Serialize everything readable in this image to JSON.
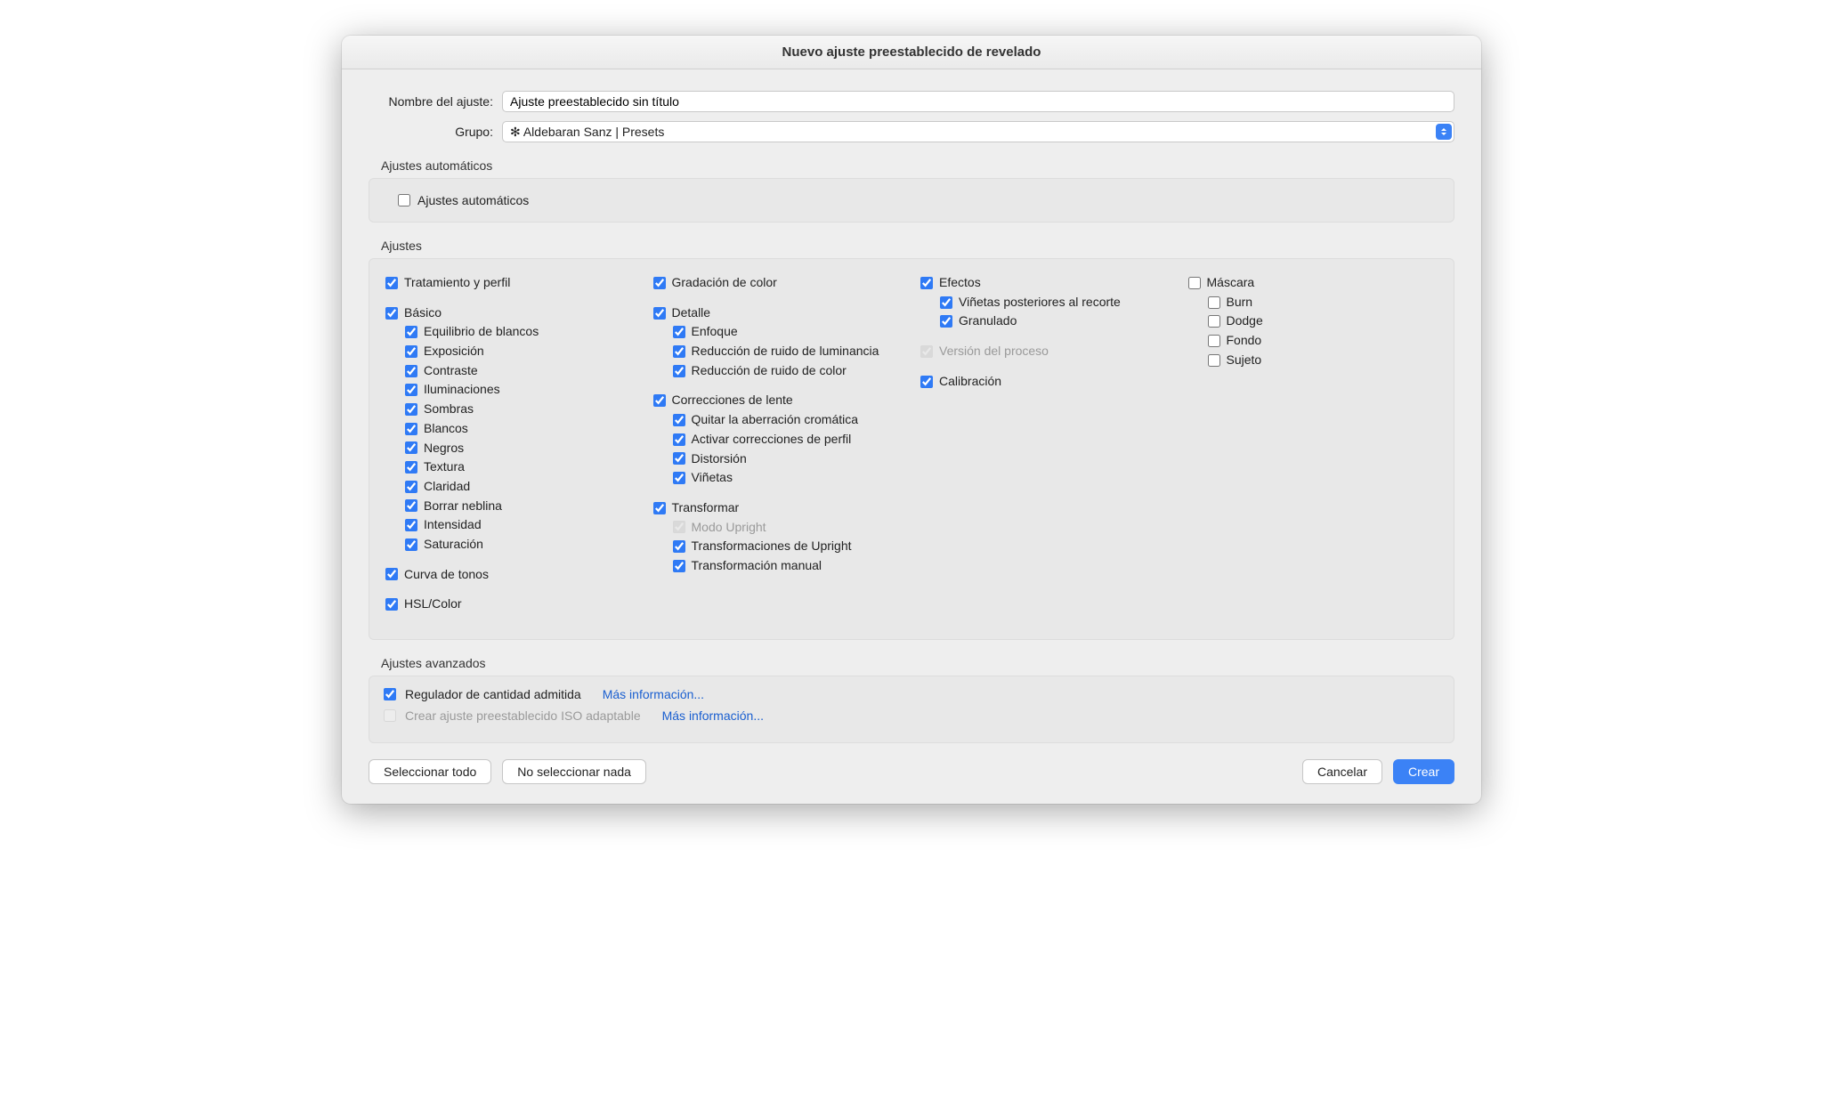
{
  "title": "Nuevo ajuste preestablecido de revelado",
  "form": {
    "name_label": "Nombre del ajuste:",
    "name_value": "Ajuste preestablecido sin título",
    "group_label": "Grupo:",
    "group_value": "✻ Aldebaran Sanz | Presets"
  },
  "auto": {
    "section": "Ajustes automáticos",
    "option": "Ajustes automáticos",
    "checked": false
  },
  "settings_title": "Ajustes",
  "col1": [
    {
      "label": "Tratamiento y perfil",
      "checked": true,
      "children": []
    },
    {
      "label": "Básico",
      "checked": true,
      "children": [
        {
          "label": "Equilibrio de blancos",
          "checked": true
        },
        {
          "label": "Exposición",
          "checked": true
        },
        {
          "label": "Contraste",
          "checked": true
        },
        {
          "label": "Iluminaciones",
          "checked": true
        },
        {
          "label": "Sombras",
          "checked": true
        },
        {
          "label": "Blancos",
          "checked": true
        },
        {
          "label": "Negros",
          "checked": true
        },
        {
          "label": "Textura",
          "checked": true
        },
        {
          "label": "Claridad",
          "checked": true
        },
        {
          "label": "Borrar neblina",
          "checked": true
        },
        {
          "label": "Intensidad",
          "checked": true
        },
        {
          "label": "Saturación",
          "checked": true
        }
      ]
    },
    {
      "label": "Curva de tonos",
      "checked": true,
      "children": []
    },
    {
      "label": "HSL/Color",
      "checked": true,
      "children": []
    }
  ],
  "col2": [
    {
      "label": "Gradación de color",
      "checked": true,
      "children": []
    },
    {
      "label": "Detalle",
      "checked": true,
      "children": [
        {
          "label": "Enfoque",
          "checked": true
        },
        {
          "label": "Reducción de ruido de luminancia",
          "checked": true
        },
        {
          "label": "Reducción de ruido de color",
          "checked": true
        }
      ]
    },
    {
      "label": "Correcciones de lente",
      "checked": true,
      "children": [
        {
          "label": "Quitar la aberración cromática",
          "checked": true
        },
        {
          "label": "Activar correcciones de perfil",
          "checked": true
        },
        {
          "label": "Distorsión",
          "checked": true
        },
        {
          "label": "Viñetas",
          "checked": true
        }
      ]
    },
    {
      "label": "Transformar",
      "checked": true,
      "children": [
        {
          "label": "Modo Upright",
          "checked": true,
          "disabled": true
        },
        {
          "label": "Transformaciones de Upright",
          "checked": true
        },
        {
          "label": "Transformación manual",
          "checked": true
        }
      ]
    }
  ],
  "col3": [
    {
      "label": "Efectos",
      "checked": true,
      "children": [
        {
          "label": "Viñetas posteriores al recorte",
          "checked": true
        },
        {
          "label": "Granulado",
          "checked": true
        }
      ]
    },
    {
      "label": "Versión del proceso",
      "checked": true,
      "disabled": true,
      "children": []
    },
    {
      "label": "Calibración",
      "checked": true,
      "children": []
    }
  ],
  "col4": [
    {
      "label": "Máscara",
      "checked": false,
      "children": [
        {
          "label": "Burn",
          "checked": false
        },
        {
          "label": "Dodge",
          "checked": false
        },
        {
          "label": "Fondo",
          "checked": false
        },
        {
          "label": "Sujeto",
          "checked": false
        }
      ]
    }
  ],
  "advanced": {
    "section": "Ajustes avanzados",
    "amount_slider": "Regulador de cantidad admitida",
    "amount_checked": true,
    "iso_adaptive": "Crear ajuste preestablecido ISO adaptable",
    "iso_checked": false,
    "more_info": "Más información..."
  },
  "footer": {
    "select_all": "Seleccionar todo",
    "select_none": "No seleccionar nada",
    "cancel": "Cancelar",
    "create": "Crear"
  }
}
